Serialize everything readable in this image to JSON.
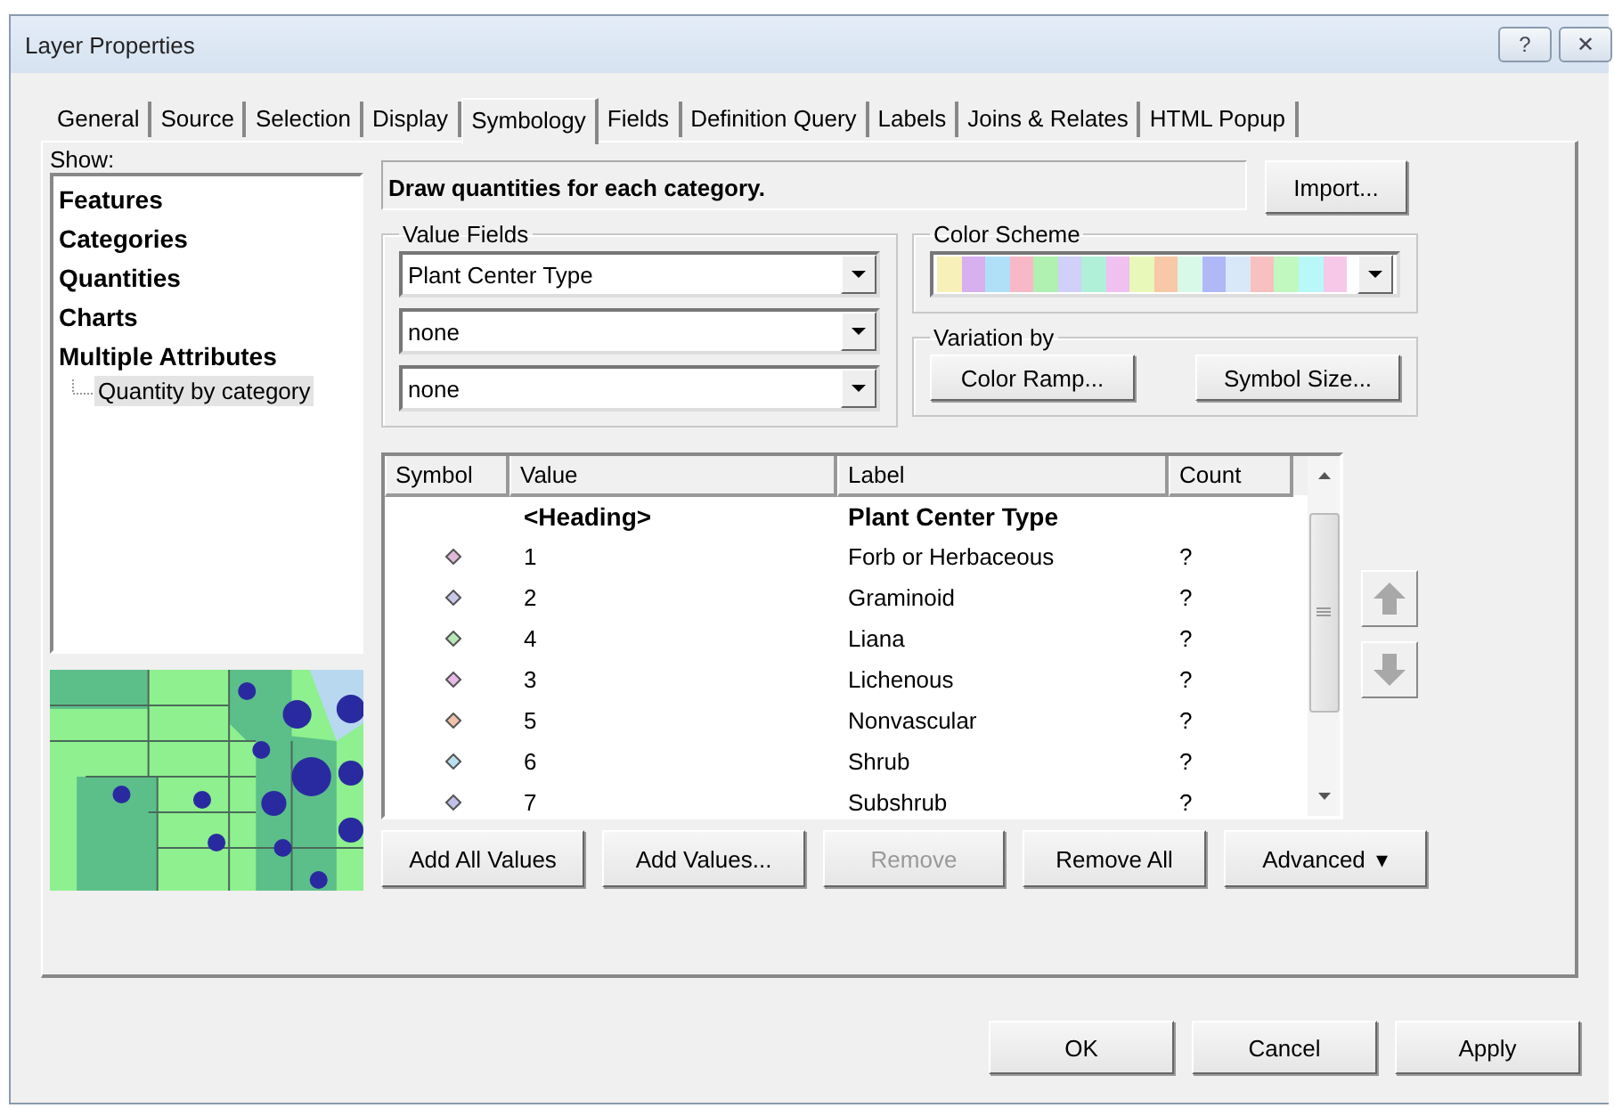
{
  "window": {
    "title": "Layer Properties",
    "title_buttons": [
      "?",
      "✕"
    ]
  },
  "tabs": [
    {
      "label": "General",
      "selected": false
    },
    {
      "label": "Source",
      "selected": false
    },
    {
      "label": "Selection",
      "selected": false
    },
    {
      "label": "Display",
      "selected": false
    },
    {
      "label": "Symbology",
      "selected": true
    },
    {
      "label": "Fields",
      "selected": false
    },
    {
      "label": "Definition Query",
      "selected": false
    },
    {
      "label": "Labels",
      "selected": false
    },
    {
      "label": "Joins & Relates",
      "selected": false
    },
    {
      "label": "HTML Popup",
      "selected": false
    }
  ],
  "show": {
    "label": "Show:",
    "items": [
      {
        "label": "Features",
        "selected": false
      },
      {
        "label": "Categories",
        "selected": false
      },
      {
        "label": "Quantities",
        "selected": false
      },
      {
        "label": "Charts",
        "selected": false
      },
      {
        "label": "Multiple Attributes",
        "selected": false,
        "children": [
          {
            "label": "Quantity by category",
            "selected": true
          }
        ]
      }
    ]
  },
  "preview": {
    "kind": "picture"
  },
  "description": "Draw quantities for each category.",
  "import_button": "Import...",
  "value_fields": {
    "label": "Value Fields",
    "fields": [
      "Plant Center Type",
      "none",
      "none"
    ]
  },
  "color_scheme": {
    "label": "Color Scheme",
    "swatches": [
      {
        "color": "#f7f0b8"
      },
      {
        "color": "#d8b0f0"
      },
      {
        "color": "#b0e0f8"
      },
      {
        "color": "#f8b8c8"
      },
      {
        "color": "#b0f0b0"
      },
      {
        "color": "#d0d0f8"
      },
      {
        "color": "#b0f0d8"
      },
      {
        "color": "#f0c0f0"
      },
      {
        "color": "#e8f8b8"
      },
      {
        "color": "#f8c8a8"
      },
      {
        "color": "#d8f8e8"
      },
      {
        "color": "#b0b8f8"
      },
      {
        "color": "#d8e8f8"
      },
      {
        "color": "#f8c0c0"
      },
      {
        "color": "#c0f8c0"
      },
      {
        "color": "#b8f8f8"
      },
      {
        "color": "#f8c8e8"
      }
    ]
  },
  "variation": {
    "label": "Variation by",
    "buttons": [
      "Color Ramp...",
      "Symbol Size..."
    ]
  },
  "table": {
    "columns": [
      "Symbol",
      "Value",
      "Label",
      "Count"
    ],
    "rows": [
      {
        "kind": "heading",
        "value": "<Heading>",
        "label": "Plant Center Type"
      },
      {
        "kind": "value",
        "color": "#e0b8d8",
        "value": "1",
        "label": "Forb or Herbaceous",
        "count": "?"
      },
      {
        "kind": "value",
        "color": "#c8c8e8",
        "value": "2",
        "label": "Graminoid",
        "count": "?"
      },
      {
        "kind": "value",
        "color": "#b8e8b8",
        "value": "4",
        "label": "Liana",
        "count": "?"
      },
      {
        "kind": "value",
        "color": "#e8b8e8",
        "value": "3",
        "label": "Lichenous",
        "count": "?"
      },
      {
        "kind": "value",
        "color": "#f0c0a8",
        "value": "5",
        "label": "Nonvascular",
        "count": "?"
      },
      {
        "kind": "value",
        "color": "#b8e0f0",
        "value": "6",
        "label": "Shrub",
        "count": "?"
      },
      {
        "kind": "value",
        "color": "#c0c0e8",
        "value": "7",
        "label": "Subshrub",
        "count": "?"
      }
    ]
  },
  "list_buttons": [
    {
      "label": "Add All Values",
      "disabled": false
    },
    {
      "label": "Add Values...",
      "disabled": false
    },
    {
      "label": "Remove",
      "disabled": true
    },
    {
      "label": "Remove All",
      "disabled": false
    },
    {
      "label": "Advanced",
      "disabled": false,
      "caret": "▾"
    }
  ],
  "dialog_buttons": [
    "OK",
    "Cancel",
    "Apply"
  ]
}
